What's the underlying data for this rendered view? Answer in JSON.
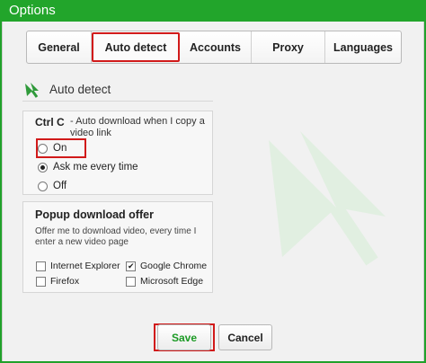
{
  "window": {
    "title": "Options"
  },
  "tabs": [
    {
      "label": "General"
    },
    {
      "label": "Auto detect"
    },
    {
      "label": "Accounts"
    },
    {
      "label": "Proxy"
    },
    {
      "label": "Languages"
    }
  ],
  "active_tab": "Auto detect",
  "section": {
    "title": "Auto detect",
    "icon": "satellite-dish-icon"
  },
  "ctrl_c": {
    "label": "Ctrl C",
    "description": "-  Auto download when I copy a video link",
    "options": [
      {
        "label": "On",
        "selected": false
      },
      {
        "label": "Ask me every time",
        "selected": true
      },
      {
        "label": "Off",
        "selected": false
      }
    ]
  },
  "popup": {
    "title": "Popup download offer",
    "description": "Offer me to download video, every time I enter a new video page",
    "browsers": [
      {
        "label": "Internet Explorer",
        "checked": false
      },
      {
        "label": "Google Chrome",
        "checked": true
      },
      {
        "label": "Firefox",
        "checked": false
      },
      {
        "label": "Microsoft Edge",
        "checked": false
      }
    ]
  },
  "buttons": {
    "save": "Save",
    "cancel": "Cancel"
  },
  "colors": {
    "brand_green": "#22a52b",
    "highlight_red": "#d11a1a",
    "watermark": "#e4f0e4"
  }
}
